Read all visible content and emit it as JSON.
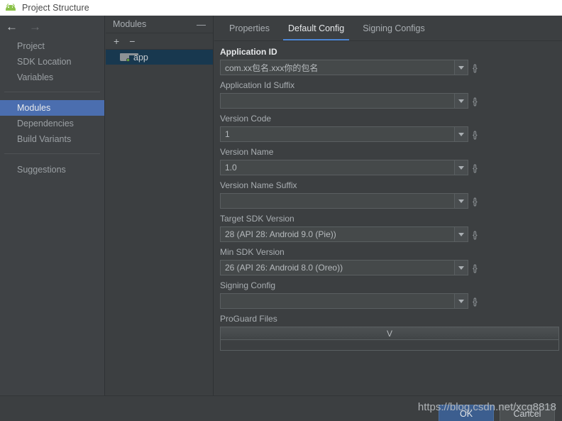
{
  "window": {
    "title": "Project Structure",
    "app_icon": "android-robot-icon"
  },
  "sidebar": {
    "back_icon": "arrow-left-icon",
    "forward_icon": "arrow-right-icon",
    "groups": [
      {
        "items": [
          {
            "label": "Project",
            "selected": false
          },
          {
            "label": "SDK Location",
            "selected": false
          },
          {
            "label": "Variables",
            "selected": false
          }
        ]
      },
      {
        "items": [
          {
            "label": "Modules",
            "selected": true
          },
          {
            "label": "Dependencies",
            "selected": false
          },
          {
            "label": "Build Variants",
            "selected": false
          }
        ]
      },
      {
        "items": [
          {
            "label": "Suggestions",
            "selected": false
          }
        ]
      }
    ]
  },
  "modules_panel": {
    "title": "Modules",
    "collapse_icon": "minus-icon",
    "toolbar": {
      "add_label": "+",
      "remove_label": "−"
    },
    "items": [
      {
        "label": "app",
        "icon": "module-folder-icon",
        "selected": true
      }
    ]
  },
  "main": {
    "tabs": [
      {
        "label": "Properties",
        "active": false
      },
      {
        "label": "Default Config",
        "active": true
      },
      {
        "label": "Signing Configs",
        "active": false
      }
    ],
    "fields": [
      {
        "label": "Application ID",
        "value": "com.xx包名.xxx你的包名",
        "strong": true,
        "dropdown_icon": "chevron-down-icon",
        "var_icon": "braces-icon"
      },
      {
        "label": "Application Id Suffix",
        "value": "",
        "strong": false,
        "dropdown_icon": "chevron-down-icon",
        "var_icon": "braces-icon"
      },
      {
        "label": "Version Code",
        "value": "1",
        "strong": false,
        "dropdown_icon": "chevron-down-icon",
        "var_icon": "braces-icon"
      },
      {
        "label": "Version Name",
        "value": "1.0",
        "strong": false,
        "dropdown_icon": "chevron-down-icon",
        "var_icon": "braces-icon"
      },
      {
        "label": "Version Name Suffix",
        "value": "",
        "strong": false,
        "dropdown_icon": "chevron-down-icon",
        "var_icon": "braces-icon"
      },
      {
        "label": "Target SDK Version",
        "value": "28 (API 28: Android 9.0 (Pie))",
        "strong": false,
        "dropdown_icon": "chevron-down-icon",
        "var_icon": "braces-icon"
      },
      {
        "label": "Min SDK Version",
        "value": "26 (API 26: Android 8.0 (Oreo))",
        "strong": false,
        "dropdown_icon": "chevron-down-icon",
        "var_icon": "braces-icon"
      },
      {
        "label": "Signing Config",
        "value": "",
        "strong": false,
        "dropdown_icon": "chevron-down-icon",
        "var_icon": "braces-icon"
      }
    ],
    "proguard": {
      "label": "ProGuard Files",
      "column_header": "V",
      "rows": []
    }
  },
  "footer": {
    "ok_label": "OK",
    "cancel_label": "Cancel"
  },
  "watermark": {
    "text": "https://blog.csdn.net/xcg8818"
  },
  "colors": {
    "accent_blue": "#4b6eaf",
    "tab_underline": "#4e87d4",
    "selection_navy": "#18384f",
    "module_badge_green": "#62b543",
    "window_bg": "#3c3f41",
    "titlebar_bg": "#ffffff"
  }
}
